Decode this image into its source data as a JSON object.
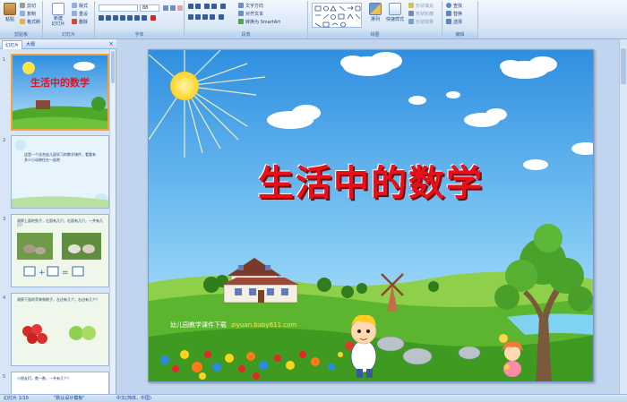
{
  "ribbon": {
    "clipboard": {
      "paste": "粘贴",
      "cut": "剪切",
      "copy": "复制",
      "format_painter": "格式刷",
      "label": "剪贴板"
    },
    "slides": {
      "new_slide": "新建\n幻灯片",
      "layout": "版式",
      "reset": "重设",
      "delete": "删除",
      "label": "幻灯片"
    },
    "font": {
      "font_size": "88",
      "label": "字体"
    },
    "paragraph": {
      "text_direction": "文字方向",
      "align_text": "对齐文本",
      "convert_smartart": "转换为 SmartArt",
      "label": "段落"
    },
    "drawing": {
      "arrange": "排列",
      "quick_styles": "快速样式",
      "shape_fill": "形状填充",
      "shape_outline": "形状轮廓",
      "shape_effects": "形状效果",
      "label": "绘图"
    },
    "editing": {
      "find": "查找",
      "replace": "替换",
      "select": "选择",
      "label": "编辑"
    }
  },
  "panel": {
    "tabs": [
      "幻灯片",
      "大纲"
    ],
    "close": "×",
    "thumbs": [
      {
        "num": "1",
        "title": "生活中的数学"
      },
      {
        "num": "2",
        "text": "这是一个适合幼儿园学习的数学课件，看看有多少小动物住在一起吧"
      },
      {
        "num": "3",
        "text": "观察上面的兔子，左面有几只，右面有几只，一共有几只？"
      },
      {
        "num": "4",
        "text": "观察下面的苹果和桃子，左边有几个，右边有几个？"
      },
      {
        "num": "5",
        "text": "小朋友们，数一数，一共有几个？"
      }
    ]
  },
  "slide": {
    "title": "生活中的数学",
    "caption_left": "幼儿园教学课件下载",
    "caption_url": "ziyuan.baby611.com"
  },
  "status": {
    "slide_pos": "幻灯片 1/10",
    "theme": "\"默认设计模板\"",
    "lang": "中文(简体，中国)"
  },
  "colors": {
    "ribbon": "#dce9f8",
    "sky_top": "#2f8fe0",
    "sky_bottom": "#bfe7fb",
    "grass": "#4ea82a",
    "title_red": "#e8101a",
    "thumb_selected": "#f3a33a"
  }
}
